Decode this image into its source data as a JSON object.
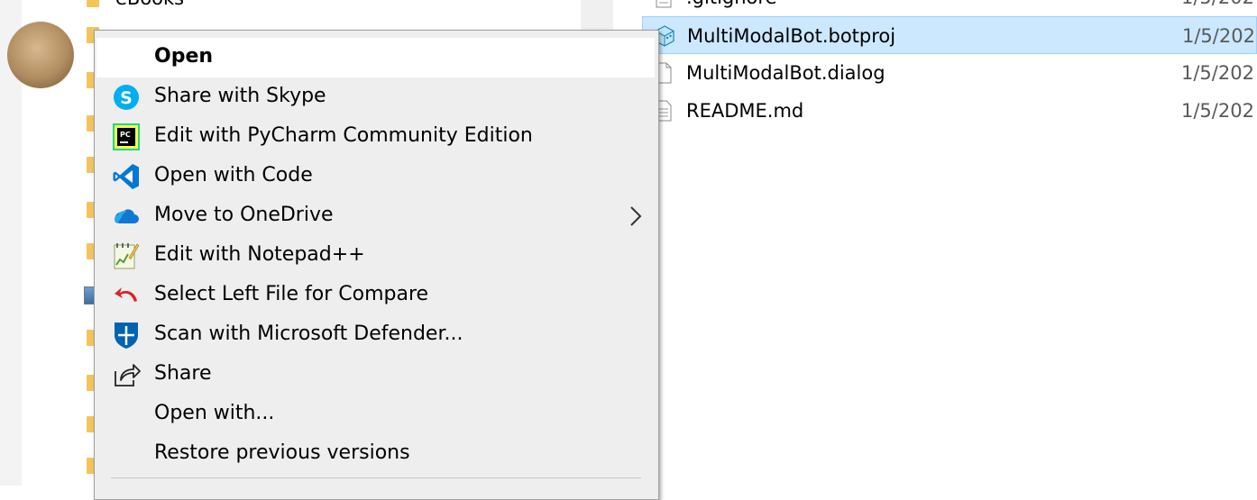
{
  "nav": {
    "partial_label": "eBooks"
  },
  "files": [
    {
      "name": ".gitignore",
      "date": "1/5/202",
      "icon": "text-file-icon",
      "selected": false
    },
    {
      "name": "MultiModalBot.botproj",
      "date": "1/5/202",
      "icon": "botproj-icon",
      "selected": true
    },
    {
      "name": "MultiModalBot.dialog",
      "date": "1/5/202",
      "icon": "blank-file-icon",
      "selected": false
    },
    {
      "name": "README.md",
      "date": "1/5/202",
      "icon": "text-file-icon",
      "selected": false
    }
  ],
  "context_menu": {
    "items": [
      {
        "label": "Open",
        "icon": "none",
        "bold": true,
        "highlighted": true
      },
      {
        "label": "Share with Skype",
        "icon": "skype-icon"
      },
      {
        "label": "Edit with PyCharm Community Edition",
        "icon": "pycharm-icon"
      },
      {
        "label": "Open with Code",
        "icon": "vscode-icon"
      },
      {
        "label": "Move to OneDrive",
        "icon": "onedrive-icon",
        "submenu": true
      },
      {
        "label": "Edit with Notepad++",
        "icon": "notepadpp-icon"
      },
      {
        "label": "Select Left File for Compare",
        "icon": "compare-arrow-icon"
      },
      {
        "label": "Scan with Microsoft Defender...",
        "icon": "defender-shield-icon"
      },
      {
        "label": "Share",
        "icon": "share-icon"
      },
      {
        "label": "Open with...",
        "icon": "none"
      },
      {
        "label": "Restore previous versions",
        "icon": "none"
      }
    ]
  },
  "colors": {
    "selection_bg": "#cce8ff",
    "selection_border": "#99d1ff",
    "menu_bg": "#eeeeee",
    "menu_highlight": "#ffffff",
    "skype_blue": "#00aff0",
    "vscode_blue": "#0078d4",
    "onedrive_blue": "#0f78d4",
    "defender_blue": "#0063b1",
    "compare_red": "#d9252a"
  }
}
